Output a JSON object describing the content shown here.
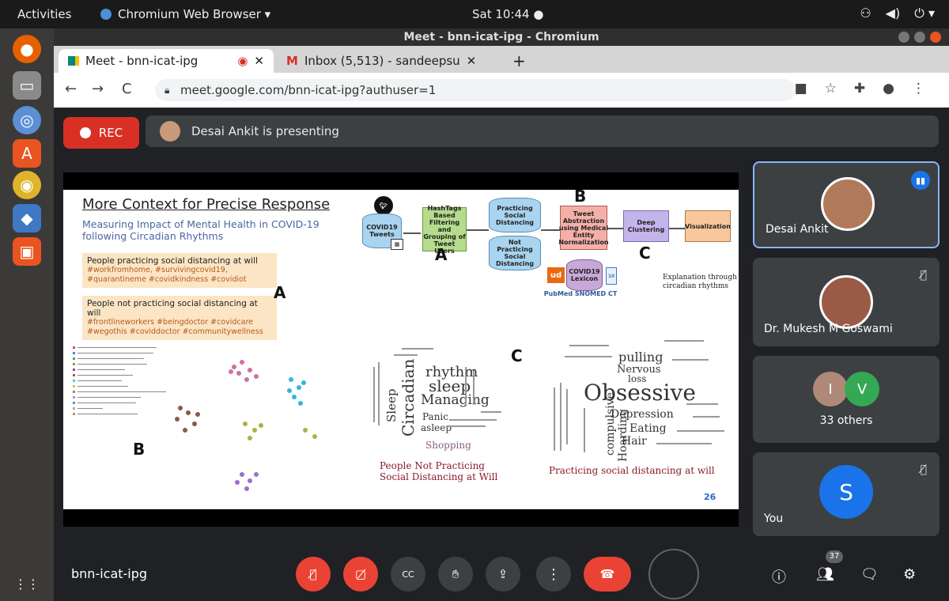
{
  "system": {
    "activities": "Activities",
    "app_name": "Chromium Web Browser ▾",
    "clock": "Sat 10:44 ●"
  },
  "window": {
    "title": "Meet - bnn-icat-ipg - Chromium"
  },
  "tabs": [
    {
      "label": "Meet - bnn-icat-ipg"
    },
    {
      "label": "Inbox (5,513) - sandeepsu"
    }
  ],
  "address": {
    "url": "meet.google.com/bnn-icat-ipg?authuser=1"
  },
  "meet": {
    "rec_label": "REC",
    "presenting_text": "Desai Ankit is presenting",
    "meeting_code": "bnn-icat-ipg",
    "participant_badge": "37"
  },
  "slide": {
    "title": "More Context for Precise Response",
    "subtitle": "Measuring Impact of Mental Health in COVID-19 following Circadian Rhythms",
    "box1_heading": "People practicing social distancing at will",
    "box1_tags": "#workfromhome, #survivingcovid19, #quarantineme #covidkindness #covidiot",
    "box2_heading": "People not practicing social distancing at will",
    "box2_tags": "#frontlineworkers #beingdoctor #covidcare #wegothis #coviddoctor #communitywellness",
    "letters": {
      "a": "A",
      "b": "B",
      "c": "C"
    },
    "flow": {
      "tweets": "COVID19 Tweets",
      "hashtags": "HashTags Based Filtering and Grouping of Tweet Users",
      "practicing": "Practicing Social Distancing",
      "not_practicing": "Not Practicing Social Distancing",
      "tweet_abstraction": "Tweet Abstraction using Medical Entity Normalization",
      "deep_clustering": "Deep Clustering",
      "visualization": "Visualization",
      "lexicon": "COVID19 Lexicon",
      "explanation": "Explanation through circadian rhythms"
    },
    "caption_left": "People Not Practicing Social Distancing at Will",
    "caption_right": "Practicing social distancing at will",
    "page_number": "26"
  },
  "participants": [
    {
      "name": "Desai Ankit"
    },
    {
      "name": "Dr. Mukesh M Goswami"
    },
    {
      "name": "33 others",
      "initials": [
        "I",
        "V"
      ]
    },
    {
      "name": "You",
      "initial": "S"
    }
  ]
}
